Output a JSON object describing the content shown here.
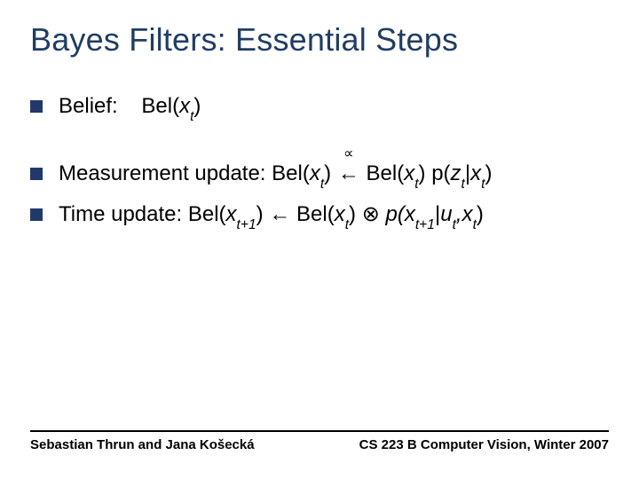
{
  "title": "Bayes Filters: Essential Steps",
  "bullets": {
    "belief_label": "Belief:",
    "belief_expr_pre": "Bel(",
    "belief_var": "x",
    "belief_sub": "t",
    "belief_expr_post": ")",
    "meas_label": "Measurement update: ",
    "meas_lhs_pre": "Bel(",
    "meas_lhs_var": "x",
    "meas_lhs_sub": "t",
    "meas_lhs_post": ") ",
    "prop_symbol": "∝",
    "left_arrow": "←",
    "meas_rhs1_pre": " Bel(",
    "meas_rhs1_var": "x",
    "meas_rhs1_sub": "t",
    "meas_rhs1_post": ") p(",
    "meas_z": "z",
    "meas_z_sub": "t",
    "meas_bar": "|",
    "meas_x2": "x",
    "meas_x2_sub": "t",
    "meas_end": ")",
    "time_label": "Time update: ",
    "time_lhs_pre": "Bel(",
    "time_lhs_var": "x",
    "time_lhs_sub": "t+1",
    "time_lhs_post": ") ",
    "time_arrow": "←",
    "time_mid_pre": " Bel(",
    "time_mid_var": "x",
    "time_mid_sub": "t",
    "time_mid_post": ") ",
    "otimes": "⊗",
    "time_p_pre": " p(",
    "time_p_x": "x",
    "time_p_x_sub": "t+1",
    "time_p_bar": "|",
    "time_p_u": "u",
    "time_p_u_sub": "t",
    "time_p_comma": ",",
    "time_p_x2": "x",
    "time_p_x2_sub": "t",
    "time_p_end": ")"
  },
  "footer": {
    "left": "Sebastian Thrun and Jana Košecká",
    "right": "CS 223 B Computer Vision, Winter 2007"
  }
}
